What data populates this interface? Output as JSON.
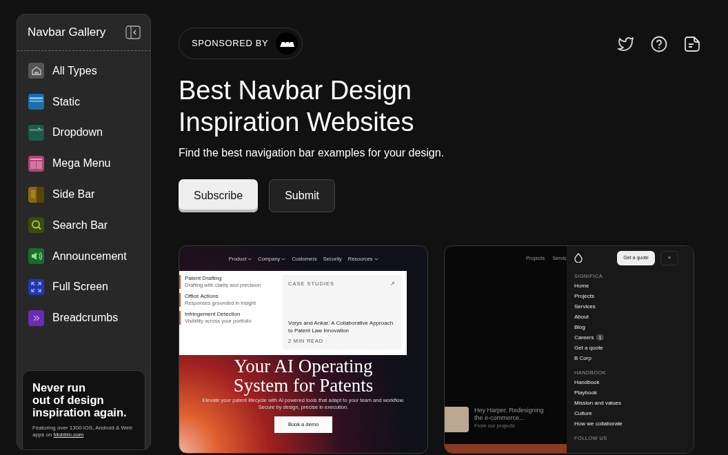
{
  "sidebar": {
    "title": "Navbar Gallery",
    "items": [
      {
        "label": "All Types",
        "kind": "home",
        "color": "#555555"
      },
      {
        "label": "Static",
        "kind": "static",
        "color": "#1a6fb0"
      },
      {
        "label": "Dropdown",
        "kind": "dropdown",
        "color": "#1d5a4a"
      },
      {
        "label": "Mega Menu",
        "kind": "mega",
        "color": "#b0457a"
      },
      {
        "label": "Side Bar",
        "kind": "sidebar",
        "color": "#8a6a10"
      },
      {
        "label": "Search Bar",
        "kind": "search",
        "color": "#3a4a10"
      },
      {
        "label": "Announcement",
        "kind": "announcement",
        "color": "#1c6b2a"
      },
      {
        "label": "Full Screen",
        "kind": "fullscreen",
        "color": "#2436b0"
      },
      {
        "label": "Breadcrumbs",
        "kind": "breadcrumbs",
        "color": "#6a2cb0"
      }
    ],
    "promo": {
      "heading_lines": [
        "Never run",
        "out of design",
        "inspiration again."
      ],
      "text": "Featuring over 1300 iOS, Android & Web apps on",
      "link": "Mobbin.com"
    }
  },
  "sponsor": {
    "label": "SPONSORED BY"
  },
  "hero": {
    "title_lines": [
      "Best Navbar Design",
      "Inspiration Websites"
    ],
    "subtitle": "Find the best navigation bar examples for your design.",
    "buttons": [
      {
        "label": "Subscribe",
        "kind": "primary"
      },
      {
        "label": "Submit",
        "kind": "secondary"
      }
    ]
  },
  "previews": [
    {
      "kind": "patents",
      "nav": [
        {
          "label": "Product",
          "dropdown": true
        },
        {
          "label": "Company",
          "dropdown": true
        },
        {
          "label": "Customers",
          "dropdown": false
        },
        {
          "label": "Security",
          "dropdown": false
        },
        {
          "label": "Resources",
          "dropdown": true
        }
      ],
      "menu_items": [
        {
          "title": "Patent Drafting",
          "desc": "Drafting with clarity and precision"
        },
        {
          "title": "Office Actions",
          "desc": "Responses grounded in insight"
        },
        {
          "title": "Infringement Detection",
          "desc": "Visibility across your portfolio"
        }
      ],
      "case_study": {
        "label": "CASE STUDIES",
        "arrow": "↗",
        "title": "Vorys and Ankar: A Collaborative Approach to Patent Law Innovation",
        "meta": "2 MIN READ"
      },
      "headline_lines": [
        "Your AI Operating",
        "System for Patents"
      ],
      "text": "Elevate your patent lifecycle with AI powered tools that adapt to your team and workflow. Secure by design, precise in execution.",
      "cta": "Book a demo"
    },
    {
      "kind": "agency",
      "nav": [
        "Projects",
        "Servic"
      ],
      "quote_button": "Get a quote",
      "close": "×",
      "sections": [
        {
          "heading": "SIGNIFICA",
          "links": [
            {
              "label": "Home"
            },
            {
              "label": "Projects"
            },
            {
              "label": "Services"
            },
            {
              "label": "About"
            },
            {
              "label": "Blog"
            },
            {
              "label": "Careers",
              "badge": "1"
            },
            {
              "label": "Get a quote"
            },
            {
              "label": "B Corp"
            }
          ]
        },
        {
          "heading": "HANDBOOK",
          "links": [
            {
              "label": "Handbook"
            },
            {
              "label": "Playbook"
            },
            {
              "label": "Mission and values"
            },
            {
              "label": "Culture"
            },
            {
              "label": "How we collaborate"
            }
          ]
        },
        {
          "heading": "FOLLOW US"
        }
      ],
      "feature": {
        "title": "Hey Harper. Redesigning the e-commerce...",
        "caption": "From our projects"
      }
    }
  ]
}
